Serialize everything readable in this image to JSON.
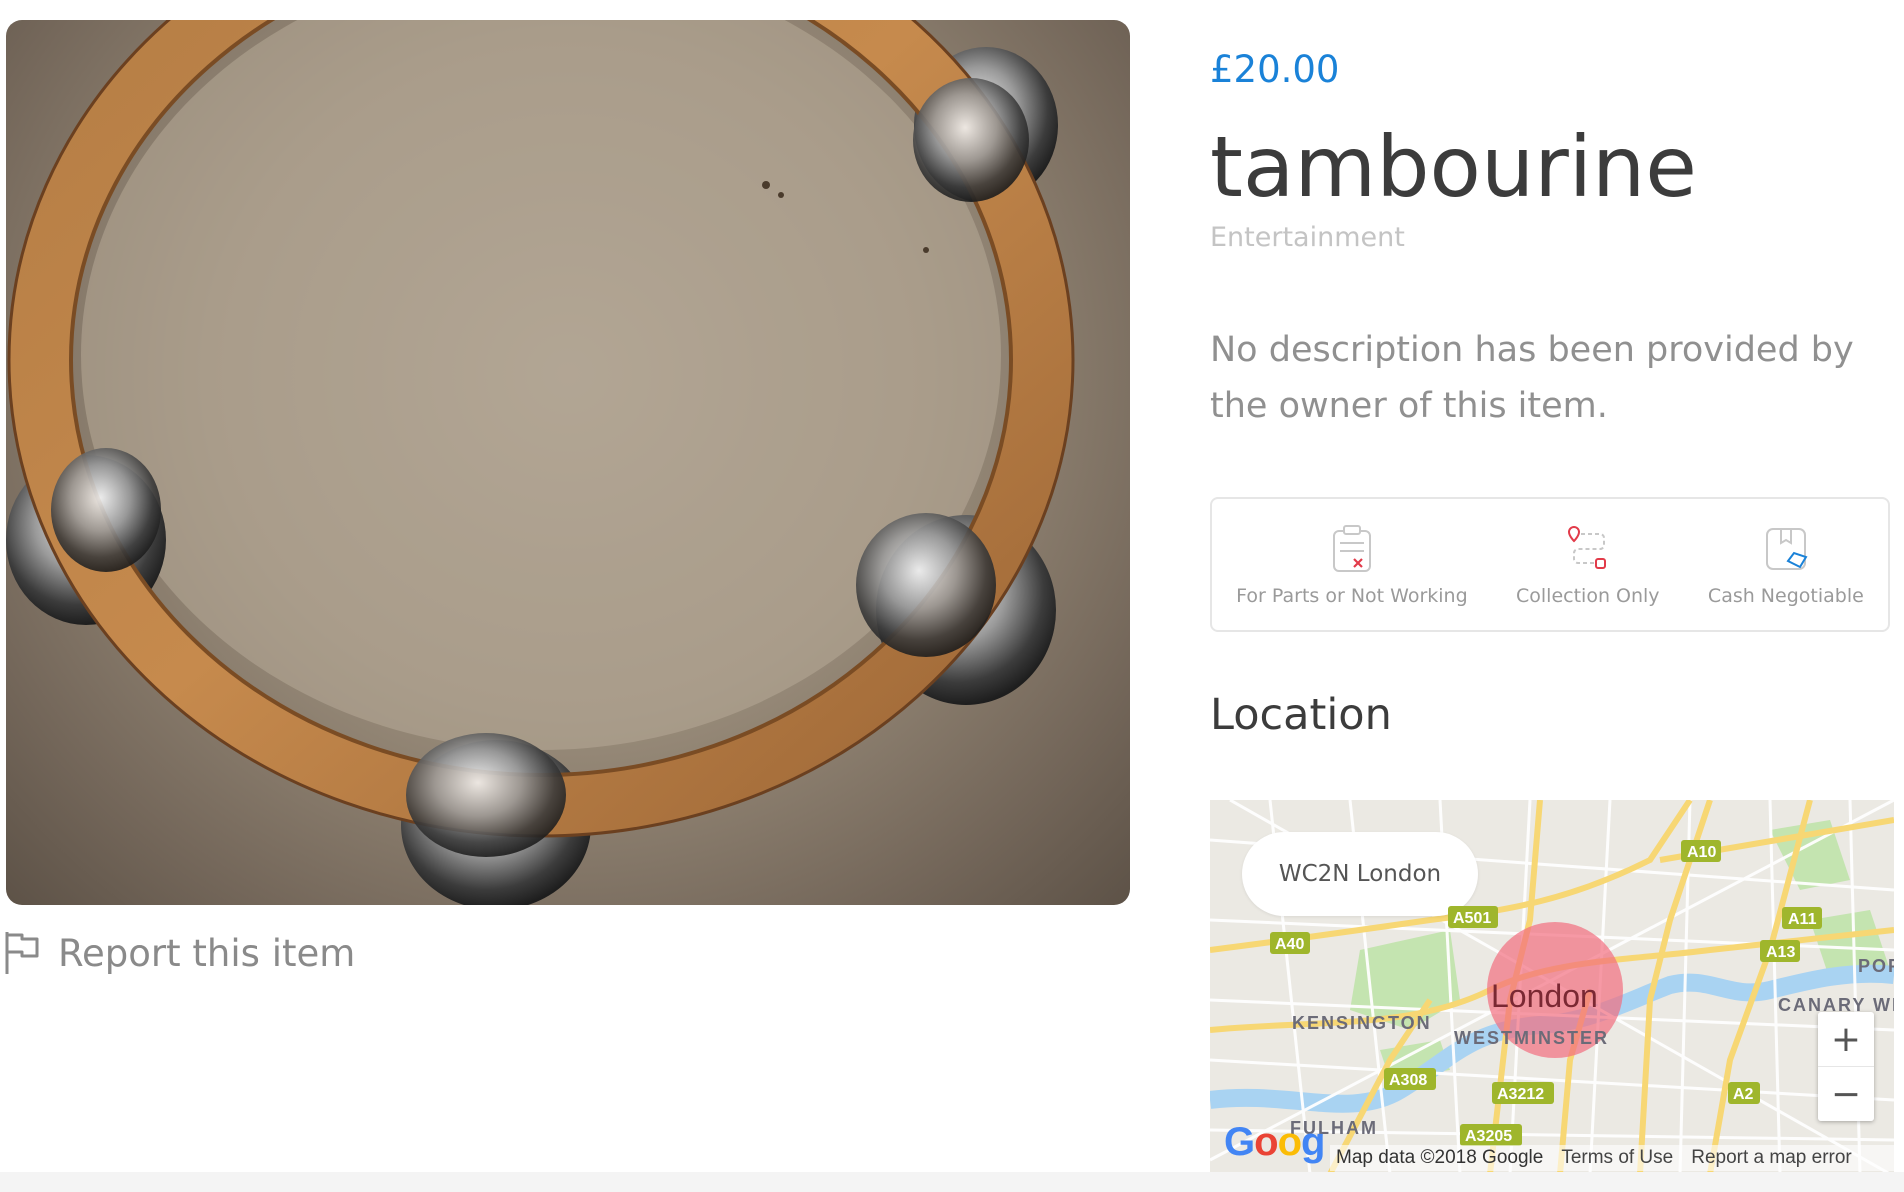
{
  "listing": {
    "price": "£20.00",
    "title": "tambourine",
    "category": "Entertainment",
    "description": "No description has been provided by the owner of this item."
  },
  "report": {
    "label": "Report this item",
    "icon": "flag-icon"
  },
  "features": [
    {
      "label": "For Parts or Not Working",
      "icon": "broken-clipboard-icon"
    },
    {
      "label": "Collection Only",
      "icon": "route-pin-icon"
    },
    {
      "label": "Cash Negotiable",
      "icon": "box-cash-icon"
    }
  ],
  "location": {
    "heading": "Location",
    "postcode": "WC2N London",
    "map": {
      "city_label": "London",
      "district_labels": [
        "KENSINGTON",
        "WESTMINSTER",
        "FULHAM",
        "CANARY WH",
        "POP"
      ],
      "road_labels": [
        "A10",
        "A501",
        "A11",
        "A40",
        "A13",
        "A308",
        "A3212",
        "A2",
        "A3205"
      ],
      "zoom_in": "+",
      "zoom_out": "−",
      "logo": "Google",
      "attribution": "Map data ©2018 Google",
      "terms": "Terms of Use",
      "report_error": "Report a map error"
    }
  },
  "colors": {
    "price": "#1a82d8",
    "road_label_bg": "#c8d53a",
    "marker": "#f26e7f"
  }
}
